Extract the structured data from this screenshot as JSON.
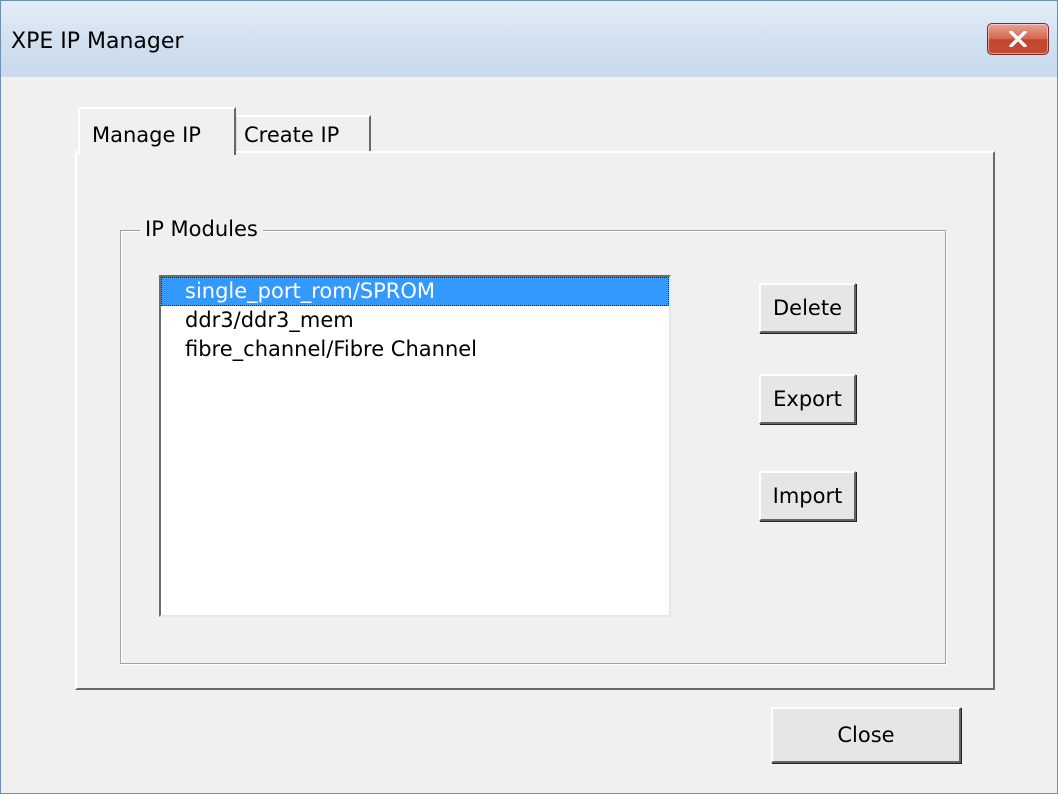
{
  "window": {
    "title": "XPE IP Manager",
    "close_icon": "close-icon"
  },
  "tabs": [
    {
      "label": "Manage IP",
      "active": true
    },
    {
      "label": "Create IP",
      "active": false
    }
  ],
  "group": {
    "label": "IP Modules"
  },
  "modules": {
    "items": [
      "single_port_rom/SPROM",
      "ddr3/ddr3_mem",
      "fibre_channel/Fibre Channel"
    ],
    "selected_index": 0
  },
  "actions": {
    "delete_label": "Delete",
    "export_label": "Export",
    "import_label": "Import"
  },
  "footer": {
    "close_label": "Close"
  },
  "colors": {
    "selection": "#3399ff",
    "close_button": "#c7432b",
    "titlebar": "#d4e3f3"
  }
}
